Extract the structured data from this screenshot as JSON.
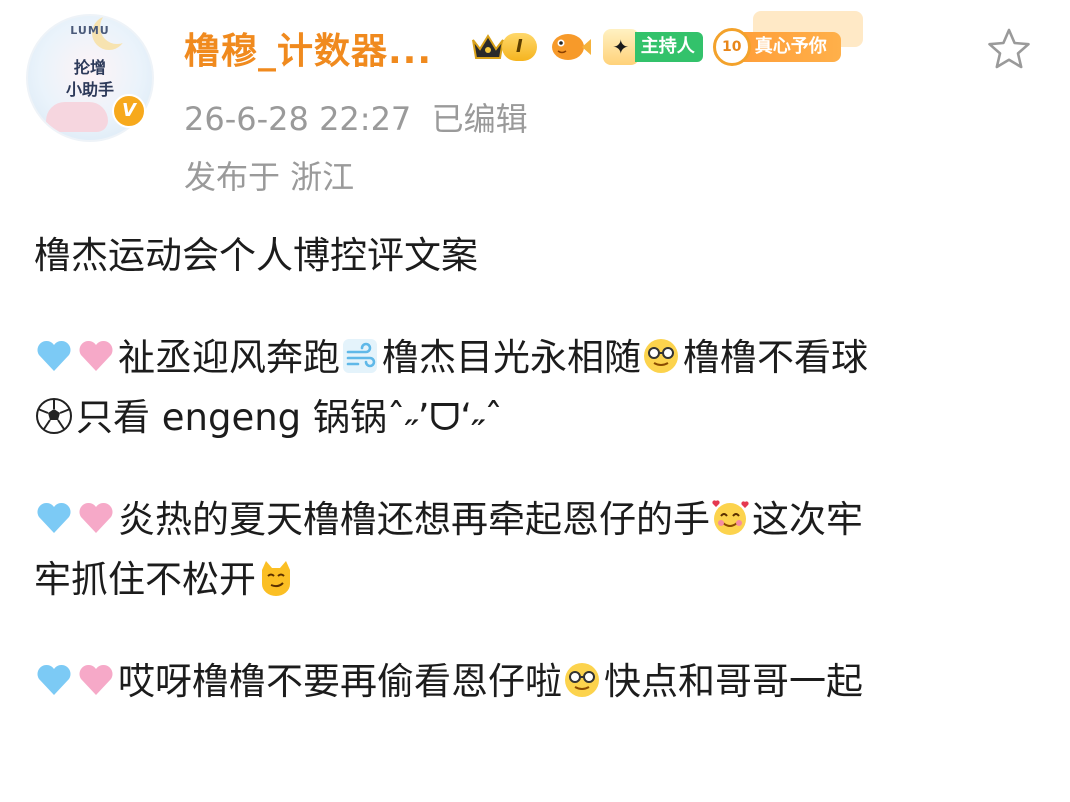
{
  "post": {
    "author": {
      "avatar_text": {
        "line0": "LUMU",
        "line1": "抡增",
        "line2": "小助手"
      },
      "verified_mark": "V",
      "username": "橹穆_计数器...",
      "badges": {
        "level": "I",
        "host_label": "主持人",
        "fan_level": "10",
        "fan_label": "真心予你"
      }
    },
    "timestamp": "26-6-28 22:27",
    "edited": "已编辑",
    "location": "发布于 浙江",
    "colors": {
      "username": "#f08a1e",
      "meta": "#9a9a9a",
      "host_badge": "#33c26b",
      "fan_badge": "#ff9f3a"
    },
    "icons": [
      "blue-heart-icon",
      "pink-heart-icon",
      "wind-icon",
      "nerd-face-icon",
      "soccer-ball-icon",
      "smiling-hearts-face-icon",
      "smirking-cat-icon",
      "star-outline-icon",
      "crown-icon",
      "pufferfish-icon"
    ]
  },
  "content": {
    "title": "橹杰运动会个人博控评文案",
    "p1_a": "祉丞迎风奔跑",
    "p1_b": "橹杰目光永相随",
    "p1_c": "橹橹不看球",
    "p1_d": "只看 engeng 锅锅ˆ˶’ᗜ‘˶ˆ",
    "p2_a": "炎热的夏天橹橹还想再牵起恩仔的手",
    "p2_b": "这次牢",
    "p2_c": "牢抓住不松开",
    "p3_a": "哎呀橹橹不要再偷看恩仔啦",
    "p3_b": "快点和哥哥一起"
  }
}
